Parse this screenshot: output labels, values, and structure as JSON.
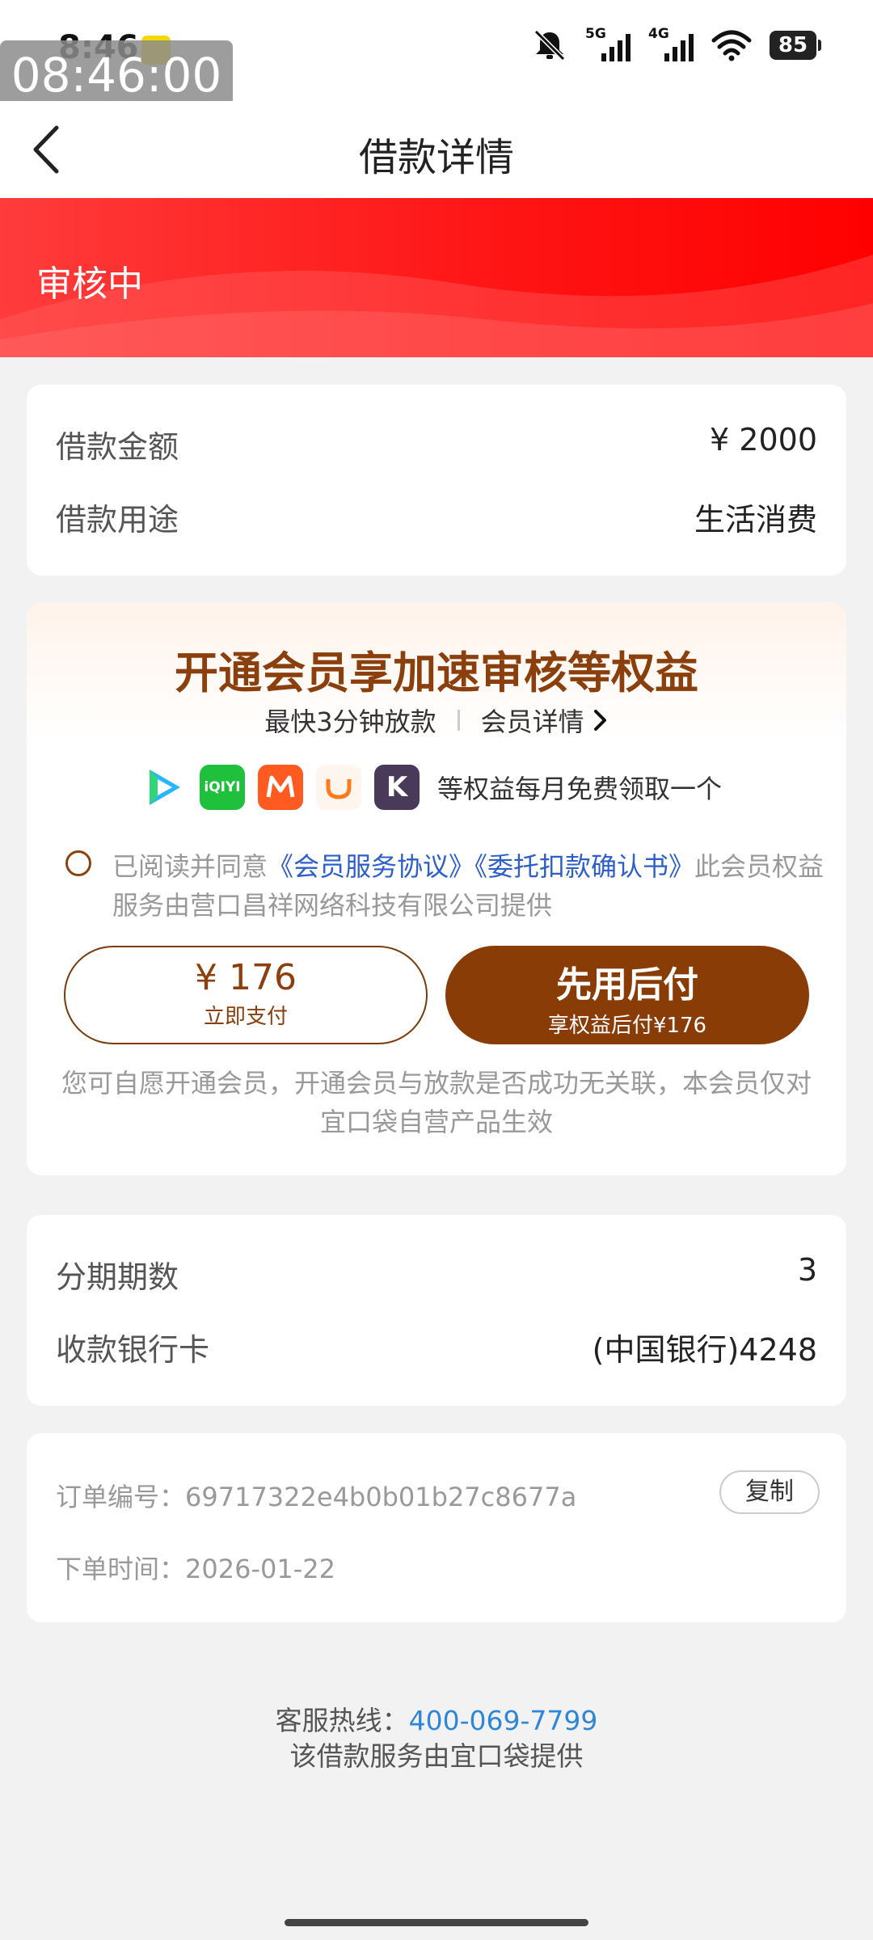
{
  "status_bar": {
    "time": "8:46",
    "time_overlay": "08:46:00",
    "network_5g": "5G",
    "network_4g": "4G",
    "battery": "85"
  },
  "nav": {
    "title": "借款详情"
  },
  "status_banner": {
    "text": "审核中"
  },
  "loan": {
    "amount_label": "借款金额",
    "amount_value": "¥ 2000",
    "purpose_label": "借款用途",
    "purpose_value": "生活消费"
  },
  "member": {
    "title": "开通会员享加速审核等权益",
    "fastest": "最快3分钟放款",
    "detail_link": "会员详情",
    "apps": [
      {
        "name": "tencent-video-icon",
        "color": "#1fb6ff"
      },
      {
        "name": "iqiyi-icon",
        "label": "iQIYI",
        "color": "#1ec03c"
      },
      {
        "name": "mango-tv-icon",
        "color": "#ff5a1f"
      },
      {
        "name": "didi-icon",
        "color": "#ff7a1a"
      },
      {
        "name": "keep-icon",
        "label": "K",
        "color": "#4a3a5a"
      }
    ],
    "apps_text": "等权益每月免费领取一个",
    "agree_prefix": "已阅读并同意",
    "agree_link1": "《会员服务协议》",
    "agree_link2": "《委托扣款确认书》",
    "agree_suffix": "此会员权益服务由营口昌祥网络科技有限公司提供",
    "pay_now_price": "¥ 176",
    "pay_now_label": "立即支付",
    "pay_later_label": "先用后付",
    "pay_later_sub": "享权益后付¥176",
    "note": "您可自愿开通会员，开通会员与放款是否成功无关联，本会员仅对宜口袋自营产品生效"
  },
  "repay": {
    "installments_label": "分期期数",
    "installments_value": "3",
    "bank_label": "收款银行卡",
    "bank_value": "(中国银行)4248"
  },
  "order": {
    "number_text": "订单编号：69717322e4b0b01b27c8677a",
    "copy_label": "复制",
    "time_text": "下单时间：2026-01-22"
  },
  "footer": {
    "hotline_label": "客服热线：",
    "hotline_number": "400-069-7799",
    "provider": "该借款服务由宜口袋提供"
  }
}
